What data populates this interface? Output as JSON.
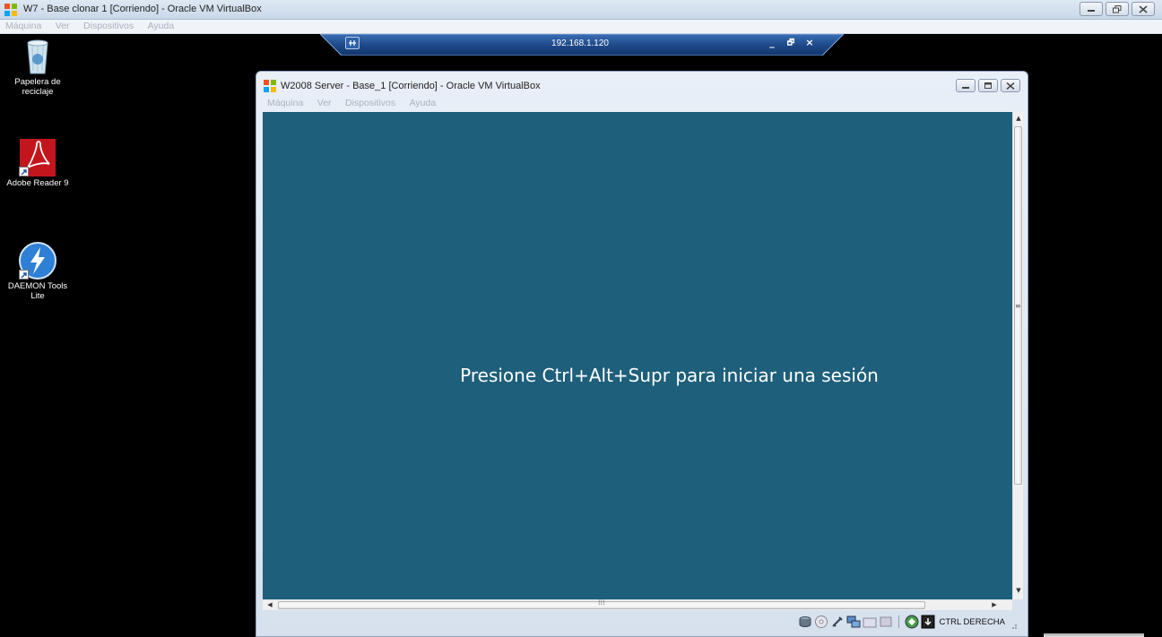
{
  "host_window": {
    "title": "W7 - Base clonar 1 [Corriendo] - Oracle VM VirtualBox",
    "menu": [
      "Máquina",
      "Ver",
      "Dispositivos",
      "Ayuda"
    ]
  },
  "rdp_bar": {
    "address": "192.168.1.120",
    "controls": {
      "minimize": "_",
      "restore": "🗗",
      "close": "×"
    }
  },
  "desktop_icons": [
    {
      "label": "Papelera de reciclaje",
      "icon": "recycle-bin-icon"
    },
    {
      "label": "Adobe Reader 9",
      "icon": "adobe-reader-icon"
    },
    {
      "label": "DAEMON Tools Lite",
      "icon": "daemon-tools-icon"
    }
  ],
  "vm_window": {
    "title": "W2008 Server - Base_1 [Corriendo] - Oracle VM VirtualBox",
    "menu": [
      "Máquina",
      "Ver",
      "Dispositivos",
      "Ayuda"
    ],
    "screen_message": "Presione Ctrl+Alt+Supr para iniciar una sesión",
    "host_key": "CTRL DERECHA",
    "status_icons": [
      "hard-disk-icon",
      "optical-drive-icon",
      "usb-icon",
      "network-icon",
      "shared-folders-icon",
      "display-icon",
      "virtualization-icon",
      "mouse-integration-icon"
    ]
  },
  "colors": {
    "vm_screen": "#1e5f7b",
    "desktop": "#000000",
    "rdp_bar": "#1f4a8a"
  }
}
